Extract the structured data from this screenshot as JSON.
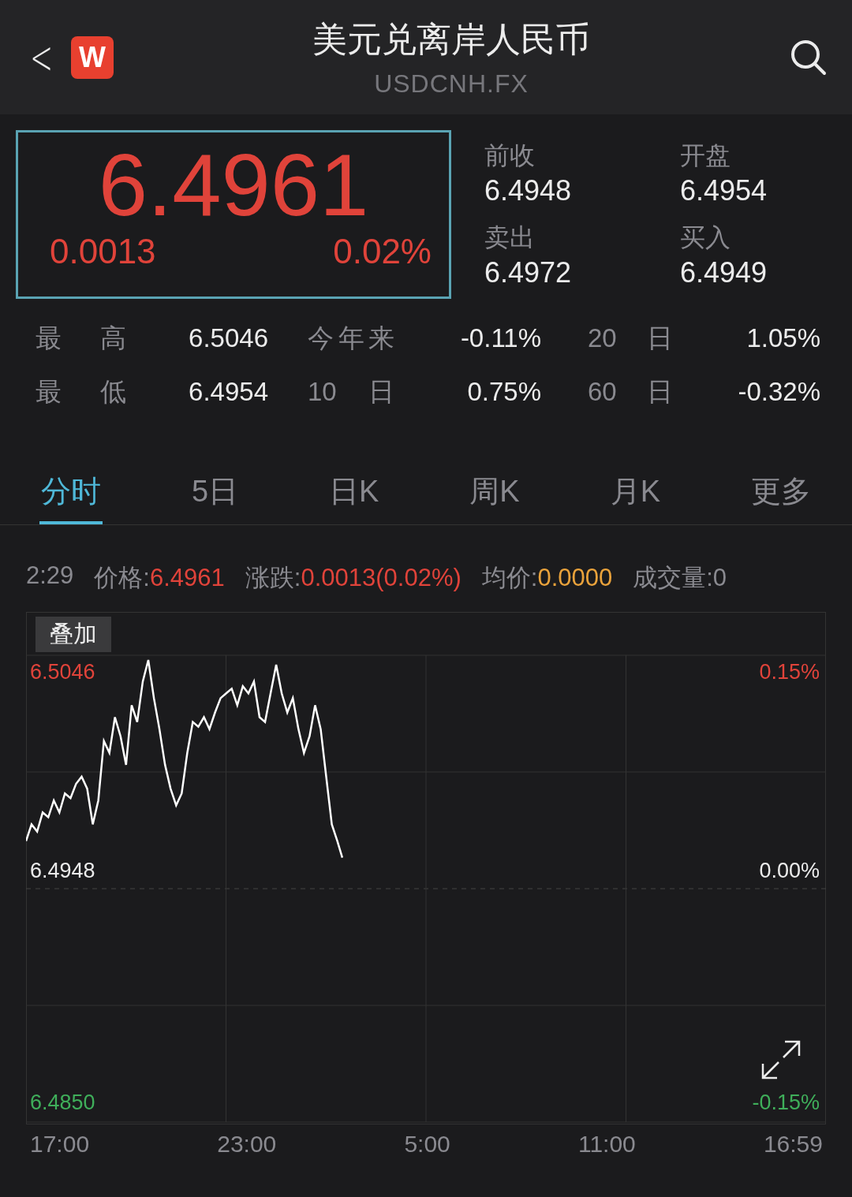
{
  "header": {
    "back": "<",
    "logo": "W",
    "title": "美元兑离岸人民币",
    "subtitle": "USDCNH.FX"
  },
  "quote": {
    "price": "6.4961",
    "change": "0.0013",
    "change_pct": "0.02%"
  },
  "quote_fields": [
    {
      "label": "前收",
      "value": "6.4948"
    },
    {
      "label": "开盘",
      "value": "6.4954"
    },
    {
      "label": "卖出",
      "value": "6.4972"
    },
    {
      "label": "买入",
      "value": "6.4949"
    }
  ],
  "stats": [
    {
      "label": "最高",
      "value": "6.5046"
    },
    {
      "label": "今年来",
      "value": "-0.11%"
    },
    {
      "label": "20日",
      "value": "1.05%"
    },
    {
      "label": "最低",
      "value": "6.4954"
    },
    {
      "label": "10日",
      "value": "0.75%"
    },
    {
      "label": "60日",
      "value": "-0.32%"
    }
  ],
  "tabs": [
    {
      "label": "分时",
      "selected": true
    },
    {
      "label": "5日",
      "selected": false
    },
    {
      "label": "日K",
      "selected": false
    },
    {
      "label": "周K",
      "selected": false
    },
    {
      "label": "月K",
      "selected": false
    },
    {
      "label": "更多",
      "selected": false
    }
  ],
  "info": {
    "time": "2:29",
    "price_label": "价格:",
    "price": "6.4961",
    "change_label": "涨跌:",
    "change": "0.0013(0.02%)",
    "avg_label": "均价:",
    "avg": "0.0000",
    "volume": "成交量:0"
  },
  "overlay_button": "叠加",
  "right_labels": [
    {
      "text": "0.15%",
      "color": "#e0433a"
    },
    {
      "text": "0.00%",
      "color": "#ececec"
    },
    {
      "text": "-0.15%",
      "color": "#3fae5a"
    }
  ],
  "time_labels": [
    "17:00",
    "23:00",
    "5:00",
    "11:00",
    "16:59"
  ],
  "price_labels": [
    {
      "text": "6.5046",
      "color": "#e0433a"
    },
    {
      "text": "6.4948",
      "color": "#ececec"
    },
    {
      "text": "6.4850",
      "color": "#3fae5a"
    }
  ]
}
